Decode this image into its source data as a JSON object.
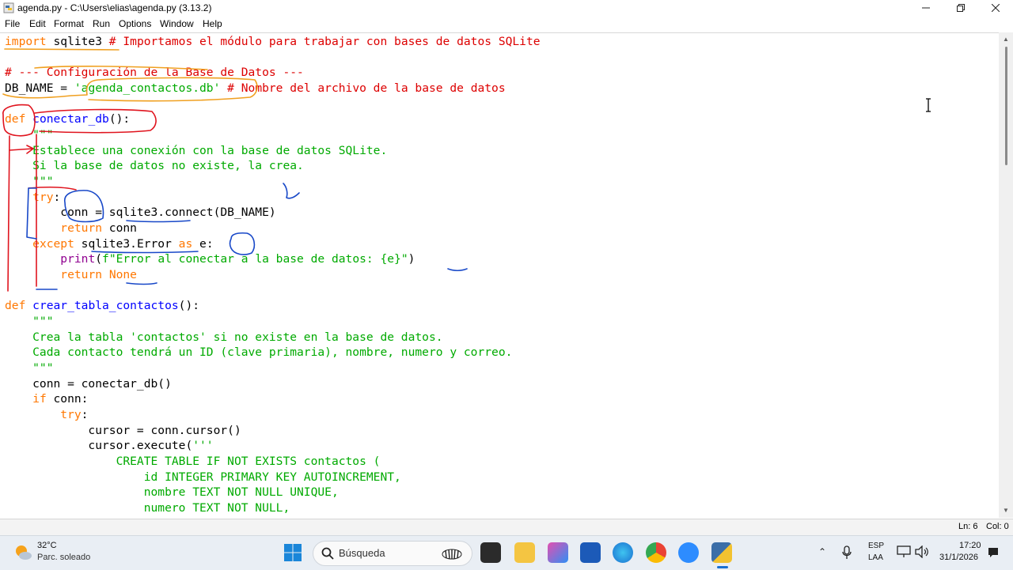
{
  "window": {
    "title": "agenda.py - C:\\Users\\elias\\agenda.py (3.13.2)"
  },
  "menu": [
    "File",
    "Edit",
    "Format",
    "Run",
    "Options",
    "Window",
    "Help"
  ],
  "code": {
    "l1_kw": "import",
    "l1_mod": " sqlite3 ",
    "l1_cmt": "# Importamos el módulo para trabajar con bases de datos SQLite",
    "l3": "# --- Configuración de la Base de Datos ---",
    "l4_a": "DB_NAME = ",
    "l4_str": "'agenda_contactos.db'",
    "l4_cmt": " # Nombre del archivo de la base de datos",
    "l6_kw": "def",
    "l6_name": "conectar_db",
    "l6_rest": "():",
    "l7": "    \"\"\"",
    "l8": "    Establece una conexión con la base de datos SQLite.",
    "l9": "    Si la base de datos no existe, la crea.",
    "l10": "    \"\"\"",
    "l11_kw": "try",
    "l11_rest": ":",
    "l12": "        conn = sqlite3.connect(DB_NAME)",
    "l13_kw": "return",
    "l13_rest": " conn",
    "l14_kw": "except",
    "l14_mid": " sqlite3.Error ",
    "l14_as": "as",
    "l14_rest": " e:",
    "l15_bi": "print",
    "l15_a": "(",
    "l15_str": "f\"Error al conectar a la base de datos: {e}\"",
    "l15_b": ")",
    "l16_kw": "return",
    "l16_none": "None",
    "l18_kw": "def",
    "l18_name": "crear_tabla_contactos",
    "l18_rest": "():",
    "l19": "    \"\"\"",
    "l20": "    Crea la tabla 'contactos' si no existe en la base de datos.",
    "l21": "    Cada contacto tendrá un ID (clave primaria), nombre, numero y correo.",
    "l22": "    \"\"\"",
    "l23": "    conn = conectar_db()",
    "l24_kw": "if",
    "l24_rest": " conn:",
    "l25_kw": "try",
    "l25_rest": ":",
    "l26": "            cursor = conn.cursor()",
    "l27_a": "            cursor.execute(",
    "l27_str": "'''",
    "l28": "                CREATE TABLE IF NOT EXISTS contactos (",
    "l29": "                    id INTEGER PRIMARY KEY AUTOINCREMENT,",
    "l30": "                    nombre TEXT NOT NULL UNIQUE,",
    "l31": "                    numero TEXT NOT NULL,"
  },
  "status": {
    "line": "Ln: 6",
    "col": "Col: 0"
  },
  "taskbar": {
    "weather_temp": "32°C",
    "weather_desc": "Parc. soleado",
    "search_placeholder": "Búsqueda",
    "lang_1": "ESP",
    "lang_2": "LAA",
    "time": "17:20",
    "date": "31/1/2026"
  },
  "colors": {
    "keyword": "#ff7700",
    "string": "#00aa00",
    "comment": "#dd0000",
    "definition": "#0000ff",
    "builtin": "#900090",
    "annotation_red": "#e0141e",
    "annotation_blue": "#1848c8",
    "annotation_orange": "#f0a020"
  }
}
